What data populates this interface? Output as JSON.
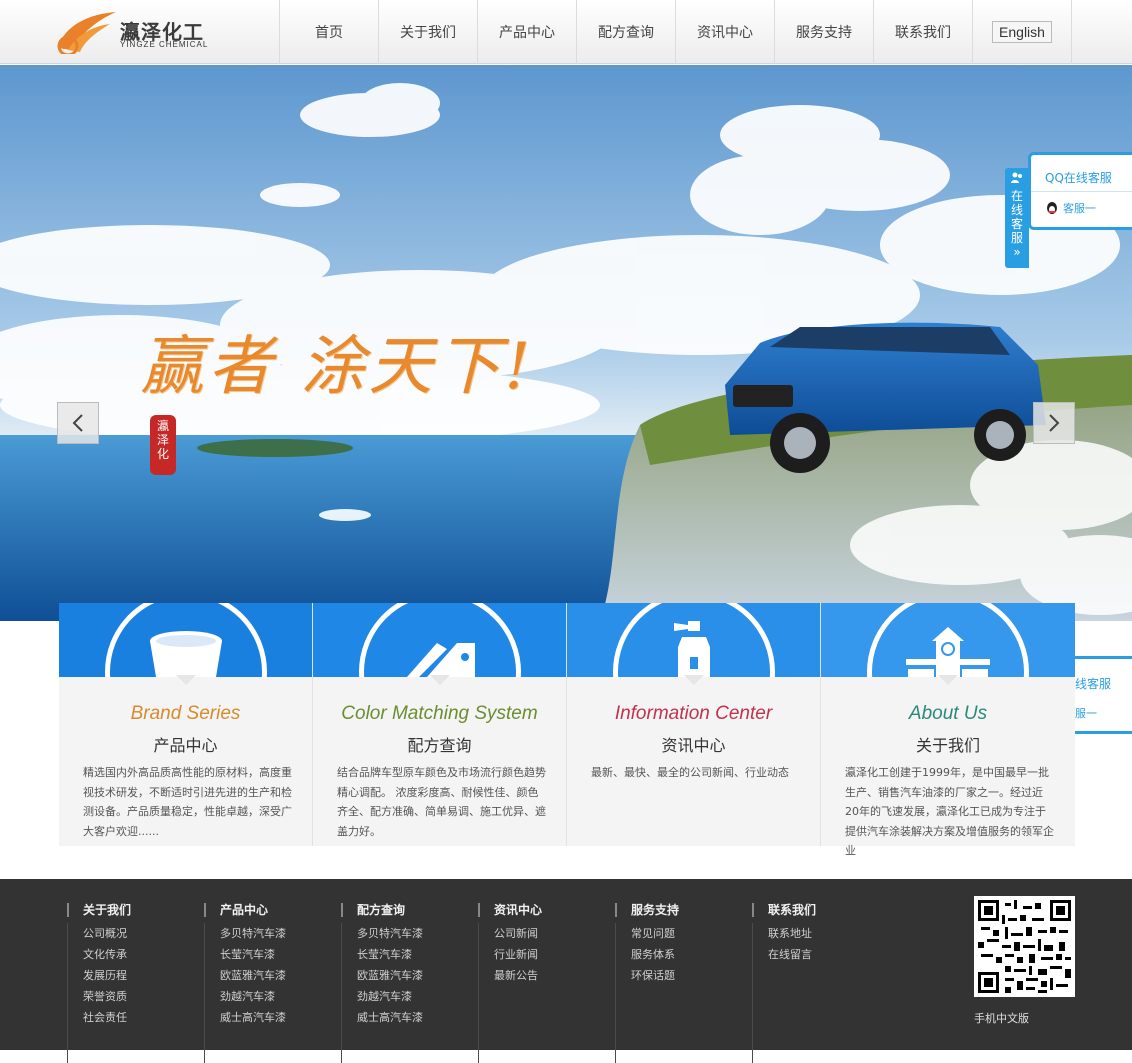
{
  "header": {
    "logo_cn": "瀛泽化工",
    "logo_en": "YINGZE CHEMICAL",
    "nav": [
      "首页",
      "关于我们",
      "产品中心",
      "配方查询",
      "资讯中心",
      "服务支持",
      "联系我们"
    ],
    "lang_button": "English"
  },
  "banner": {
    "slogan": "赢者 涂天下!",
    "seal": "瀛泽化工"
  },
  "qq": {
    "tab_label": "在线客服",
    "title": "QQ在线客服",
    "item": "客服一",
    "title_partial": "线客服",
    "item_partial": "服一"
  },
  "cards": [
    {
      "en": "Brand Series",
      "cn": "产品中心",
      "desc": "精选国内外高品质高性能的原材料，高度重视技术研发，不断适时引进先进的生产和检测设备。产品质量稳定，性能卓越，深受广大客户欢迎......",
      "color": "#d98a2a"
    },
    {
      "en": "Color Matching System",
      "cn": "配方查询",
      "desc": "结合品牌车型原车颜色及市场流行颜色趋势精心调配。 浓度彩度高、耐候性佳、颜色齐全、配方准确、简单易调、施工优异、遮盖力好。",
      "color": "#6b8e2f"
    },
    {
      "en": "Information Center",
      "cn": "资讯中心",
      "desc": "最新、最快、最全的公司新闻、行业动态",
      "color": "#c0334d"
    },
    {
      "en": "About Us",
      "cn": "关于我们",
      "desc": "瀛泽化工创建于1999年，是中国最早一批生产、销售汽车油漆的厂家之一。经过近20年的飞速发展，瀛泽化工已成为专注于提供汽车涂装解决方案及增值服务的领军企业",
      "color": "#2a8a7a"
    }
  ],
  "footer": {
    "columns": [
      {
        "title": "关于我们",
        "items": [
          "公司概况",
          "文化传承",
          "发展历程",
          "荣誉资质",
          "社会责任"
        ]
      },
      {
        "title": "产品中心",
        "items": [
          "多贝特汽车漆",
          "长莹汽车漆",
          "欧蓝雅汽车漆",
          "劲越汽车漆",
          "威士高汽车漆"
        ]
      },
      {
        "title": "配方查询",
        "items": [
          "多贝特汽车漆",
          "长莹汽车漆",
          "欧蓝雅汽车漆",
          "劲越汽车漆",
          "威士高汽车漆"
        ]
      },
      {
        "title": "资讯中心",
        "items": [
          "公司新闻",
          "行业新闻",
          "最新公告"
        ]
      },
      {
        "title": "服务支持",
        "items": [
          "常见问题",
          "服务体系",
          "环保话题"
        ]
      },
      {
        "title": "联系我们",
        "items": [
          "联系地址",
          "在线留言"
        ]
      }
    ],
    "qr_label": "手机中文版"
  }
}
